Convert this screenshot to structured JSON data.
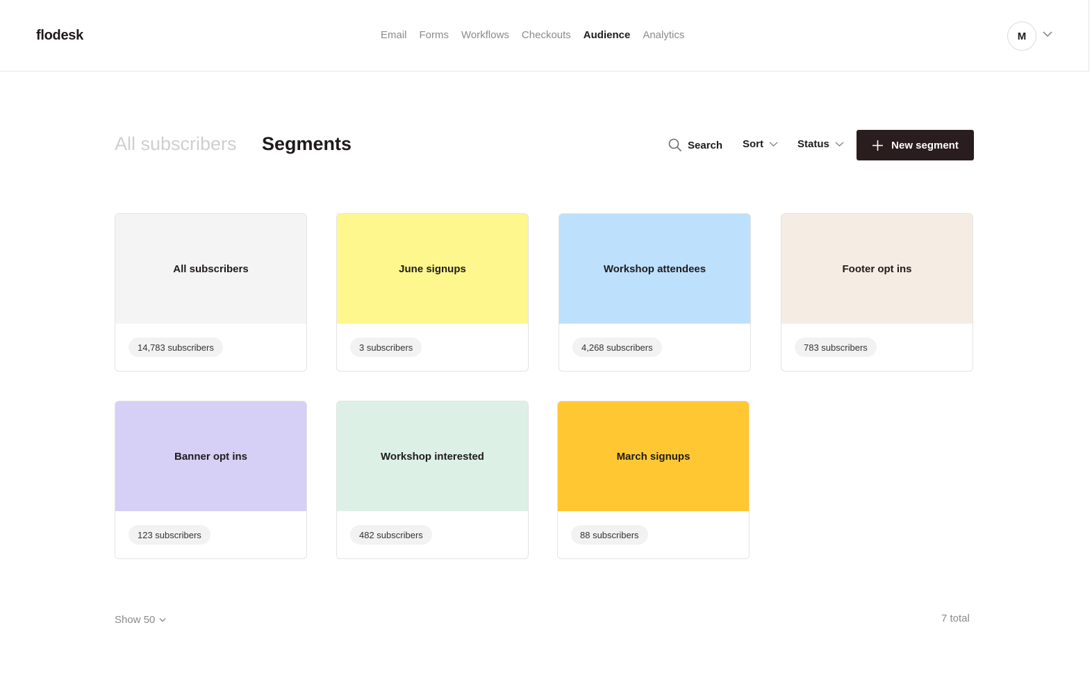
{
  "app": {
    "logo": "flodesk"
  },
  "nav": {
    "items": [
      "Email",
      "Forms",
      "Workflows",
      "Checkouts",
      "Audience",
      "Analytics"
    ],
    "active": "Audience"
  },
  "user": {
    "initial": "M"
  },
  "tabs": {
    "all_subscribers": "All subscribers",
    "segments": "Segments"
  },
  "toolbar": {
    "search": "Search",
    "sort": "Sort",
    "status": "Status",
    "new_segment": "New segment"
  },
  "segments": [
    {
      "name": "All subscribers",
      "count": "14,783 subscribers",
      "color": "#f4f4f4"
    },
    {
      "name": "June signups",
      "count": "3 subscribers",
      "color": "#fdf78d"
    },
    {
      "name": "Workshop attendees",
      "count": "4,268 subscribers",
      "color": "#bde0fd"
    },
    {
      "name": "Footer opt ins",
      "count": "783 subscribers",
      "color": "#f5ece3"
    },
    {
      "name": "Banner opt ins",
      "count": "123 subscribers",
      "color": "#d6d0f7"
    },
    {
      "name": "Workshop interested",
      "count": "482 subscribers",
      "color": "#ddf0e6"
    },
    {
      "name": "March signups",
      "count": "88 subscribers",
      "color": "#ffc832"
    }
  ],
  "footer": {
    "show": "Show 50",
    "total": "7 total"
  }
}
